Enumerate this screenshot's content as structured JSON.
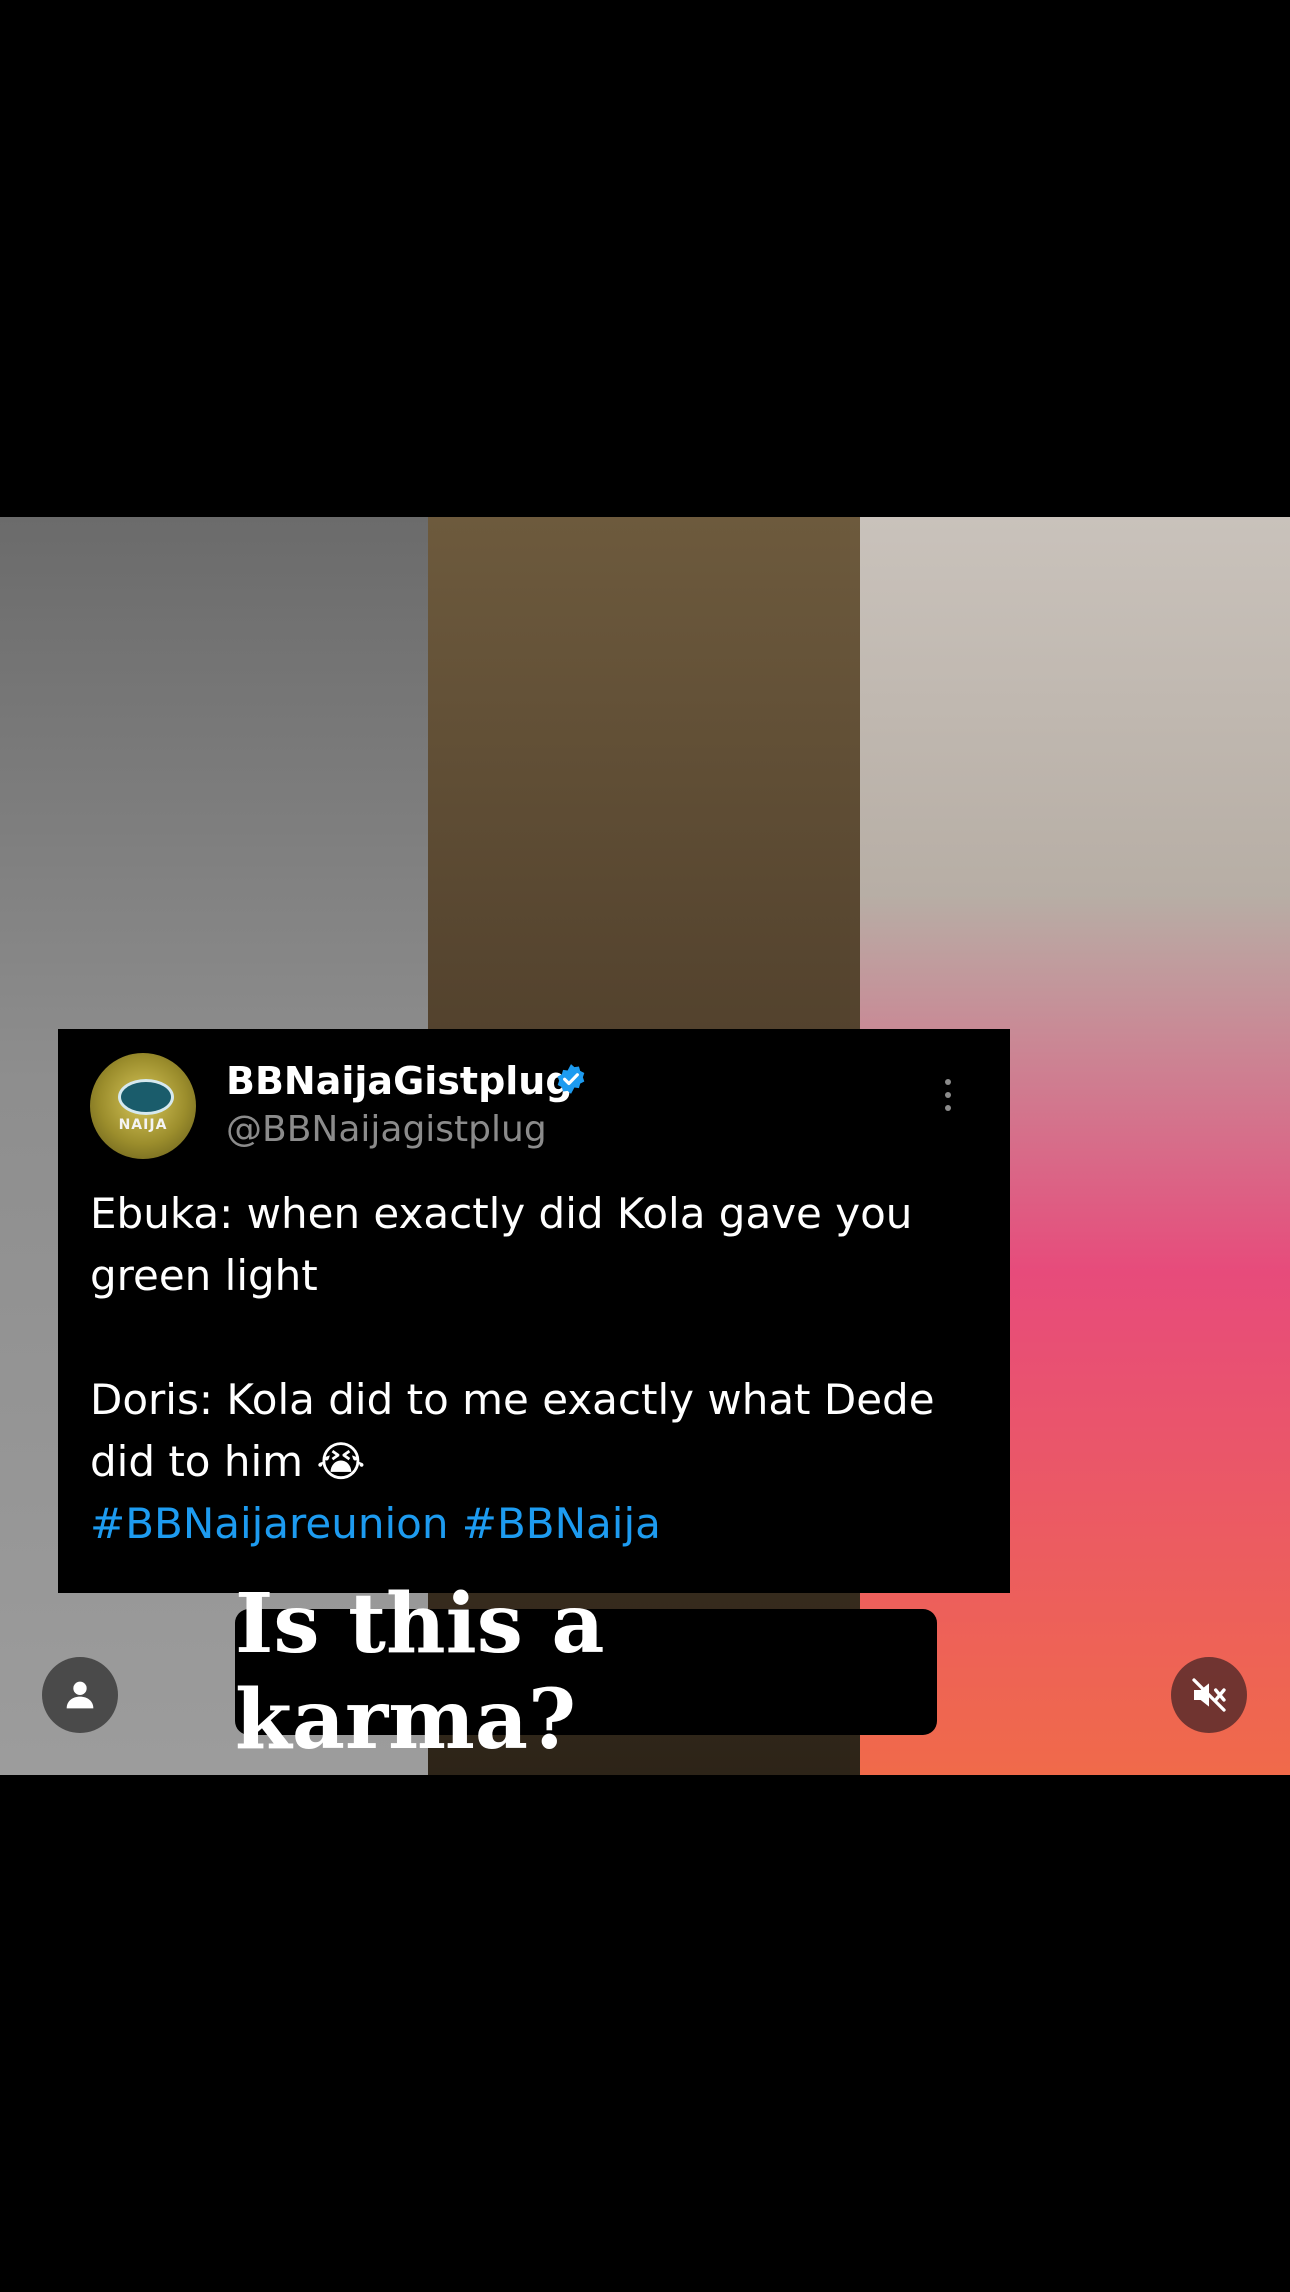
{
  "post": {
    "tweet": {
      "display_name": "BBNaijaGistplug",
      "handle": "@BBNaijagistplug",
      "avatar_text": "NAIJA",
      "lines": [
        "Ebuka: when exactly did Kola gave you",
        "green light",
        "Doris: Kola did to me exactly what Dede",
        "did to him 😭"
      ],
      "hashtags": "#BBNaijareunion #BBNaija"
    },
    "caption": "Is this a karma?"
  },
  "colors": {
    "hashtag": "#1d9bf0",
    "verified": "#1d9bf0",
    "background": "#000000"
  },
  "icons": {
    "left_button": "user-icon",
    "right_button": "mute-icon",
    "tweet_menu": "more-vertical-icon"
  }
}
